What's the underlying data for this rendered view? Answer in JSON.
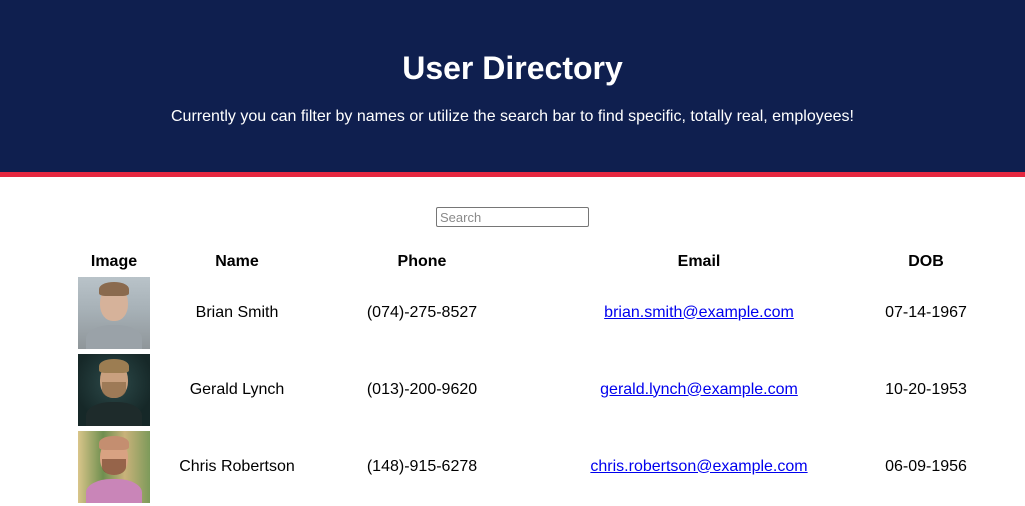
{
  "header": {
    "title": "User Directory",
    "subtitle": "Currently you can filter by names or utilize the search bar to find specific, totally real, employees!"
  },
  "search": {
    "placeholder": "Search",
    "value": ""
  },
  "table": {
    "columns": [
      "Image",
      "Name",
      "Phone",
      "Email",
      "DOB"
    ],
    "rows": [
      {
        "name": "Brian Smith",
        "phone": "(074)-275-8527",
        "email": "brian.smith@example.com",
        "dob": "07-14-1967",
        "avatar": "brian-smith-photo"
      },
      {
        "name": "Gerald Lynch",
        "phone": "(013)-200-9620",
        "email": "gerald.lynch@example.com",
        "dob": "10-20-1953",
        "avatar": "gerald-lynch-photo"
      },
      {
        "name": "Chris Robertson",
        "phone": "(148)-915-6278",
        "email": "chris.robertson@example.com",
        "dob": "06-09-1956",
        "avatar": "chris-robertson-photo"
      }
    ]
  },
  "colors": {
    "header_bg": "#0f1f4f",
    "accent_bar": "#e5273f",
    "link": "#0000ee"
  }
}
